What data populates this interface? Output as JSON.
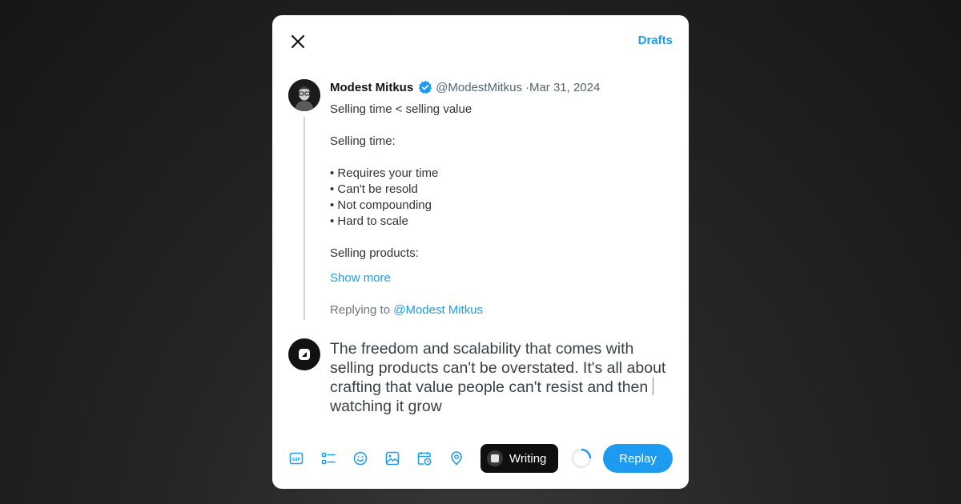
{
  "header": {
    "drafts_label": "Drafts"
  },
  "original_tweet": {
    "author_name": "Modest Mitkus",
    "handle": "@ModestMitkus",
    "date": "·Mar 31, 2024",
    "lines": [
      "Selling time < selling value",
      "",
      "Selling time:",
      "",
      "• Requires your time",
      "• Can't be resold",
      "• Not compounding",
      "• Hard to scale",
      "",
      "Selling products:"
    ],
    "show_more_label": "Show more",
    "replying_prefix": "Replying to",
    "replying_mention": "@Modest Mitkus"
  },
  "compose": {
    "text_before_caret": "The freedom and scalability that comes with selling products can't be overstated. It's all about crafting that value people can't resist and then ",
    "text_after_caret": "watching it grow"
  },
  "toolbar": {
    "icons": [
      "gif-icon",
      "poll-icon",
      "emoji-icon",
      "image-icon",
      "schedule-icon",
      "location-icon"
    ],
    "writing_label": "Writing",
    "reply_label": "Replay"
  },
  "colors": {
    "accent": "#1d9bf0",
    "writing_bg": "#0f0f0f"
  }
}
